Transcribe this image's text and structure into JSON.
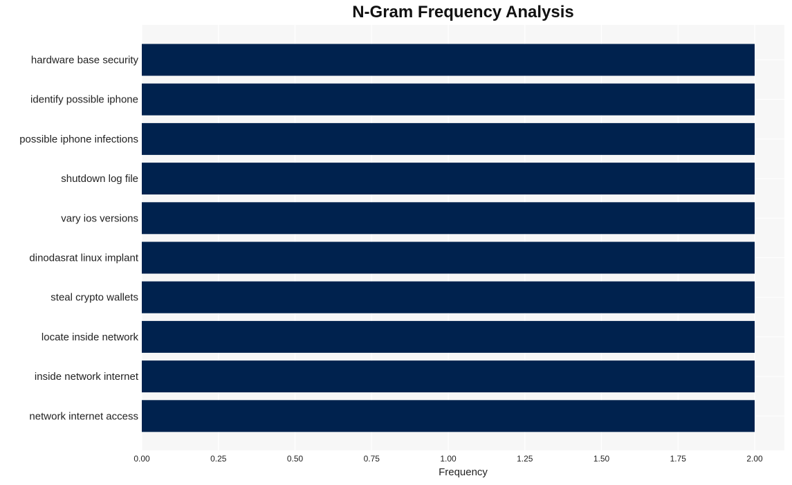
{
  "chart_data": {
    "type": "bar",
    "orientation": "horizontal",
    "title": "N-Gram Frequency Analysis",
    "xlabel": "Frequency",
    "ylabel": "",
    "categories": [
      "hardware base security",
      "identify possible iphone",
      "possible iphone infections",
      "shutdown log file",
      "vary ios versions",
      "dinodasrat linux implant",
      "steal crypto wallets",
      "locate inside network",
      "inside network internet",
      "network internet access"
    ],
    "values": [
      2,
      2,
      2,
      2,
      2,
      2,
      2,
      2,
      2,
      2
    ],
    "xlim": [
      0,
      2.1
    ],
    "xticks": [
      "0.00",
      "0.25",
      "0.50",
      "0.75",
      "1.00",
      "1.25",
      "1.50",
      "1.75",
      "2.00"
    ],
    "grid": true,
    "legend": "none",
    "colors": {
      "bar": "#00224e",
      "plot_bg": "#f7f7f7",
      "grid": "#ffffff"
    }
  }
}
